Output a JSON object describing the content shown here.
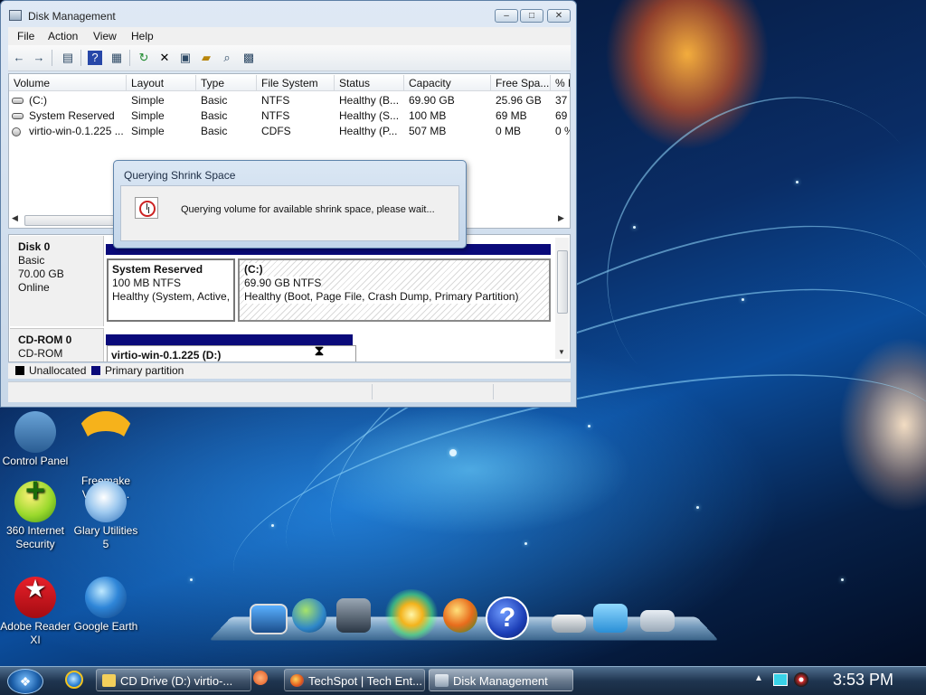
{
  "window": {
    "title": "Disk Management",
    "controls": {
      "minimize": "–",
      "maximize": "□",
      "close": "✕"
    },
    "menu": [
      "File",
      "Action",
      "View",
      "Help"
    ]
  },
  "toolbar_icons": [
    "back-icon",
    "forward-icon",
    "console-tree-icon",
    "help-icon",
    "properties-icon",
    "refresh-icon",
    "delete-icon",
    "settings-icon",
    "open-folder-icon",
    "find-icon",
    "rescan-icon"
  ],
  "volume_list": {
    "columns": [
      "Volume",
      "Layout",
      "Type",
      "File System",
      "Status",
      "Capacity",
      "Free Spa...",
      "% F"
    ],
    "rows": [
      [
        "(C:)",
        "Simple",
        "Basic",
        "NTFS",
        "Healthy (B...",
        "69.90 GB",
        "25.96 GB",
        "37"
      ],
      [
        "System Reserved",
        "Simple",
        "Basic",
        "NTFS",
        "Healthy (S...",
        "100 MB",
        "69 MB",
        "69"
      ],
      [
        "virtio-win-0.1.225 ...",
        "Simple",
        "Basic",
        "CDFS",
        "Healthy (P...",
        "507 MB",
        "0 MB",
        "0 %"
      ]
    ]
  },
  "disks": [
    {
      "name": "Disk 0",
      "type": "Basic",
      "size": "70.00 GB",
      "status": "Online",
      "partitions": [
        {
          "name": "System Reserved",
          "size": "100 MB NTFS",
          "status": "Healthy (System, Active, Primary Partition)"
        },
        {
          "name": "(C:)",
          "size": "69.90 GB NTFS",
          "status": "Healthy (Boot, Page File, Crash Dump, Primary Partition)"
        }
      ]
    },
    {
      "name": "CD-ROM 0",
      "type": "CD-ROM",
      "partitions": [
        {
          "name": "virtio-win-0.1.225  (D:)"
        }
      ]
    }
  ],
  "legend": [
    {
      "label": "Unallocated",
      "color": "#000000"
    },
    {
      "label": "Primary partition",
      "color": "#0a0a7a"
    }
  ],
  "dialog": {
    "title": "Querying Shrink Space",
    "message": "Querying volume for available shrink space, please wait..."
  },
  "desktop_icons": [
    {
      "label": "Control Panel"
    },
    {
      "label": "Freemake Video C..."
    },
    {
      "label": "360 Internet Security"
    },
    {
      "label": "Glary Utilities 5"
    },
    {
      "label": "Adobe Reader XI"
    },
    {
      "label": "Google Earth"
    }
  ],
  "taskbar": {
    "buttons": [
      "CD Drive (D:) virtio-...",
      "TechSpot | Tech Ent...",
      "Disk Management"
    ],
    "active": "Disk Management",
    "clock": "3:53 PM"
  }
}
